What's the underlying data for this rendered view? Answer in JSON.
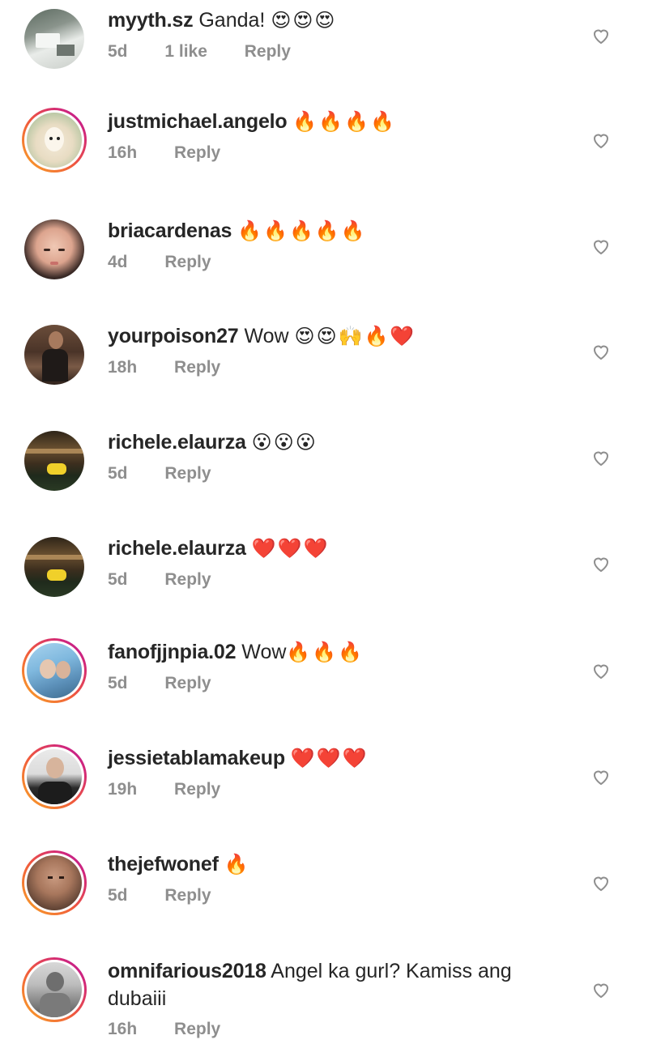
{
  "accent_ring_colors": [
    "#f9a826",
    "#f05a3c",
    "#d1267a",
    "#b01ca8"
  ],
  "meta_color": "#8e8e8e",
  "reply_label": "Reply",
  "comments": [
    {
      "username": "myyth.sz",
      "text": "Ganda!",
      "emoji": "😍😍😍",
      "time": "5d",
      "likes": "1 like",
      "ring": false,
      "avatar": "desk-photo"
    },
    {
      "username": "justmichael.angelo",
      "text": "",
      "emoji": "🔥🔥🔥🔥",
      "time": "16h",
      "likes": "",
      "ring": true,
      "avatar": "alpaca"
    },
    {
      "username": "briacardenas",
      "text": "",
      "emoji": "🔥🔥🔥🔥🔥",
      "time": "4d",
      "likes": "",
      "ring": false,
      "avatar": "woman-face"
    },
    {
      "username": "yourpoison27",
      "text": "Wow",
      "emoji": "😍😍🙌🔥❤️",
      "time": "18h",
      "likes": "",
      "ring": false,
      "avatar": "man-mirror"
    },
    {
      "username": "richele.elaurza",
      "text": "",
      "emoji": "😮😮😮",
      "time": "5d",
      "likes": "",
      "ring": false,
      "avatar": "night-pool"
    },
    {
      "username": "richele.elaurza",
      "text": "",
      "emoji": "❤️❤️❤️",
      "time": "5d",
      "likes": "",
      "ring": false,
      "avatar": "night-pool"
    },
    {
      "username": "fanofjjnpia.02",
      "text": "Wow",
      "emoji": "🔥🔥🔥",
      "time": "5d",
      "likes": "",
      "ring": true,
      "avatar": "couple-sky"
    },
    {
      "username": "jessietablamakeup",
      "text": "",
      "emoji": "❤️❤️❤️",
      "time": "19h",
      "likes": "",
      "ring": true,
      "avatar": "man-suit"
    },
    {
      "username": "thejefwonef",
      "text": "",
      "emoji": "🔥",
      "time": "5d",
      "likes": "",
      "ring": true,
      "avatar": "man-closeup"
    },
    {
      "username": "omnifarious2018",
      "text": "Angel ka gurl? Kamiss ang",
      "text2": "dubaiii",
      "emoji": "",
      "time": "16h",
      "likes": "",
      "ring": true,
      "avatar": "man-grey"
    }
  ]
}
